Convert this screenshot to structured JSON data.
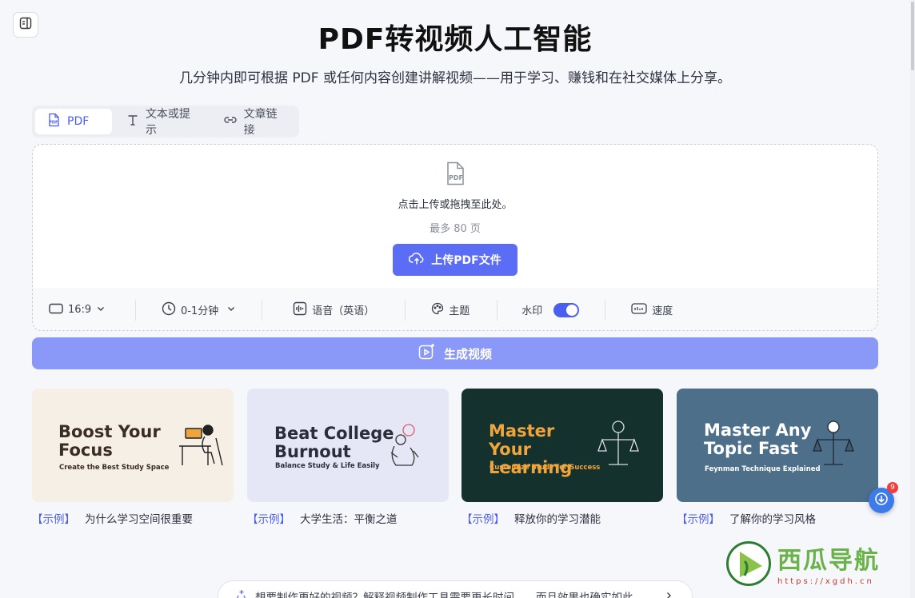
{
  "header": {
    "title": "PDF转视频人工智能",
    "subtitle": "几分钟内即可根据 PDF 或任何内容创建讲解视频——用于学习、赚钱和在社交媒体上分享。"
  },
  "tabs": [
    {
      "label": "PDF",
      "icon": "pdf-icon",
      "active": true
    },
    {
      "label": "文本或提示",
      "icon": "text-icon",
      "active": false
    },
    {
      "label": "文章链接",
      "icon": "link-icon",
      "active": false
    }
  ],
  "upload": {
    "prompt": "点击上传或拖拽至此处。",
    "limit": "最多 80 页",
    "button_label": "上传PDF文件"
  },
  "options": {
    "aspect_ratio": "16:9",
    "duration": "0-1分钟",
    "voice": "语音（英语）",
    "theme": "主题",
    "watermark_label": "水印",
    "watermark_on": true,
    "speed": "速度"
  },
  "generate_label": "生成视频",
  "examples": [
    {
      "tag": "【示例】",
      "caption": "为什么学习空间很重要",
      "thumb_title": "Boost Your Focus",
      "thumb_sub": "Create the Best Study Space",
      "bg": "#f5efe6",
      "fg": "#3b2d22"
    },
    {
      "tag": "【示例】",
      "caption": "大学生活：平衡之道",
      "thumb_title": "Beat College Burnout",
      "thumb_sub": "Balance Study & Life Easily",
      "bg": "#e6e7f6",
      "fg": "#2b2e3a"
    },
    {
      "tag": "【示例】",
      "caption": "释放你的学习潜能",
      "thumb_title": "Master Your Learning",
      "thumb_sub": "Customize Study for Success",
      "bg": "#14312e",
      "fg": "#f0a43c"
    },
    {
      "tag": "【示例】",
      "caption": "了解你的学习风格",
      "thumb_title": "Master Any Topic Fast",
      "thumb_sub": "Feynman Technique Explained",
      "bg": "#4d6f8a",
      "fg": "#ffffff"
    }
  ],
  "float_badge_count": "9",
  "bottom_banner": "想要制作更好的视频？解释视频制作工具需要更长时间——而且效果也确实如此。",
  "watermark": {
    "title": "西瓜导航",
    "url": "https://xgdh.cn"
  },
  "colors": {
    "accent": "#4a5ef0",
    "upload_button": "#5b6cf5",
    "generate_button": "#8a98f7"
  }
}
